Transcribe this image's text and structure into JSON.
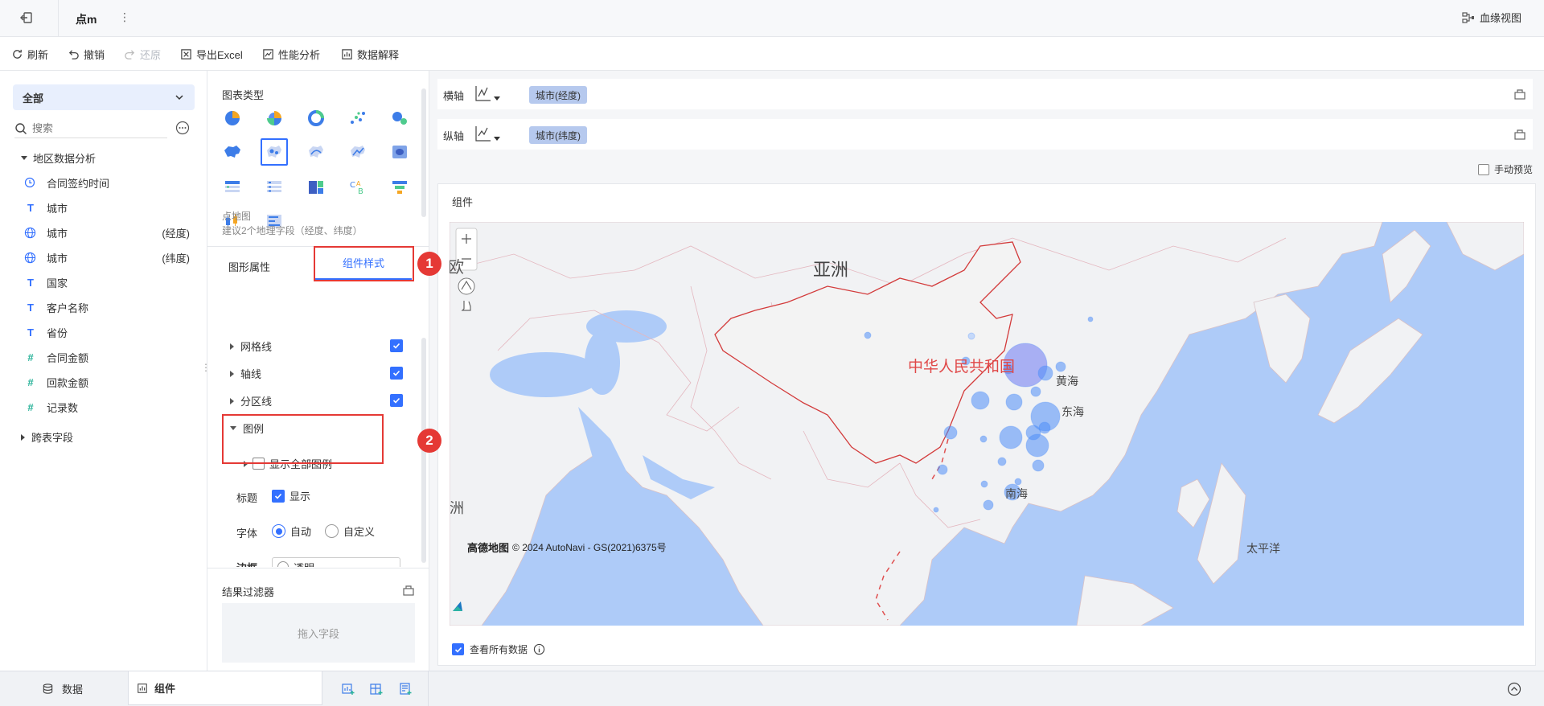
{
  "topbar": {
    "tab_title": "点m",
    "lineage_label": "血缘视图"
  },
  "toolbar": {
    "refresh": "刷新",
    "undo": "撤销",
    "redo": "还原",
    "export_excel": "导出Excel",
    "perf_analysis": "性能分析",
    "data_explain": "数据解释"
  },
  "fields": {
    "scope_select": "全部",
    "search_placeholder": "搜索",
    "group_title": "地区数据分析",
    "items": [
      {
        "label": "合同签约时间",
        "suffix": ""
      },
      {
        "label": "城市",
        "suffix": ""
      },
      {
        "label": "城市",
        "suffix": "(经度)"
      },
      {
        "label": "城市",
        "suffix": "(纬度)"
      },
      {
        "label": "国家",
        "suffix": ""
      },
      {
        "label": "客户名称",
        "suffix": ""
      },
      {
        "label": "省份",
        "suffix": ""
      },
      {
        "label": "合同金额",
        "suffix": ""
      },
      {
        "label": "回款金额",
        "suffix": ""
      },
      {
        "label": "记录数",
        "suffix": ""
      }
    ],
    "cross_table": "跨表字段"
  },
  "config": {
    "chart_type_title": "图表类型",
    "chart_name": "点地图",
    "chart_hint": "建议2个地理字段（经度、纬度）",
    "tab_graph_props": "图形属性",
    "tab_component_style": "组件样式",
    "marker_1": "1",
    "marker_2": "2",
    "sections": {
      "gridline": "网格线",
      "axisline": "轴线",
      "zoneline": "分区线",
      "legend": "图例",
      "show_all_legend": "显示全部图例"
    },
    "title_label": "标题",
    "title_show": "显示",
    "font_label": "字体",
    "font_auto": "自动",
    "font_custom": "自定义",
    "bg_label": "边框",
    "bg_value": "透明",
    "result_filter": "结果过滤器",
    "drop_hint": "拖入字段"
  },
  "axes": {
    "x_label": "横轴",
    "x_field": "城市(经度)",
    "y_label": "纵轴",
    "y_field": "城市(纬度)",
    "manual_preview": "手动预览"
  },
  "component": {
    "title": "组件",
    "view_all_data": "查看所有数据",
    "map_labels": {
      "asia": "亚洲",
      "europe": "欧",
      "africa_cut": "洲",
      "china": "中华人民共和国",
      "yellow_sea": "黄海",
      "east_sea": "东海",
      "south_sea": "南海",
      "pacific": "太平洋"
    },
    "attribution_brand": "高德地图",
    "attribution_text": "© 2024 AutoNavi - GS(2021)6375号"
  },
  "bottom": {
    "data_tab": "数据",
    "component_tab": "组件"
  },
  "colors": {
    "accent": "#3370ff",
    "highlight": "#e53935",
    "bubble": "#4f8ef7",
    "ocean": "#aecbf8",
    "land": "#f2f2f2"
  }
}
